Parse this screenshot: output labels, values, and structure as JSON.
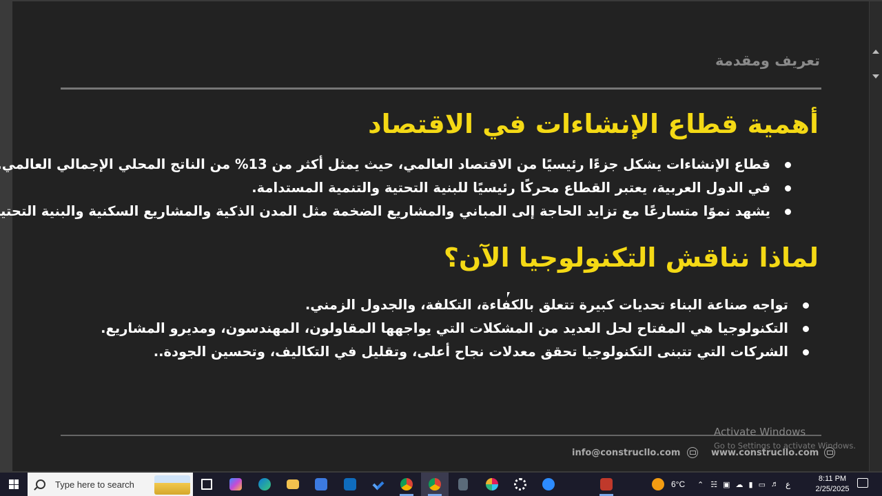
{
  "slide": {
    "section_label": "تعريف ومقدمة",
    "heading1": "أهمية قطاع الإنشاءات في الاقتصاد",
    "bullets1": [
      "قطاع الإنشاءات يشكل جزءًا رئيسيًا من الاقتصاد العالمي، حيث يمثل أكثر من 13% من الناتج المحلي الإجمالي العالمي.",
      "في الدول العربية، يعتبر القطاع محركًا رئيسيًا للبنية التحتية والتنمية المستدامة.",
      "يشهد نموًا متسارعًا مع تزايد الحاجة إلى المباني والمشاريع الضخمة مثل المدن الذكية والمشاريع السكنية والبنية التحتية."
    ],
    "heading2": "لماذا نناقش التكنولوجيا الآن؟",
    "bullets2": [
      "تواجه صناعة البناء تحديات كبيرة تتعلق بالكفاءة، التكلفة، والجدول الزمني.",
      "التكنولوجيا هي المفتاح لحل العديد من المشكلات التي يواجهها المقاولون، المهندسون، ومديرو المشاريع.",
      "الشركات التي تتبنى التكنولوجيا تحقق معدلات نجاح أعلى، وتقليل في التكاليف، وتحسين الجودة.."
    ],
    "footer_email": "info@construcllo.com",
    "footer_website": "www.construcllo.com",
    "heading_color": "#f4d915"
  },
  "watermark": {
    "line1": "Activate Windows",
    "line2": "Go to Settings to activate Windows."
  },
  "taskbar": {
    "search_placeholder": "Type here to search",
    "weather": "6°C",
    "lang": "ع",
    "time": "8:11 PM",
    "date": "2/25/2025",
    "icons": [
      "task-view-icon",
      "copilot-icon",
      "edge-icon",
      "file-explorer-icon",
      "store-icon",
      "outlook-icon",
      "todo-icon",
      "chrome-profile-icon",
      "chrome-icon",
      "calculator-icon",
      "slack-icon",
      "settings-icon",
      "zoom-icon",
      "app-icon"
    ]
  }
}
